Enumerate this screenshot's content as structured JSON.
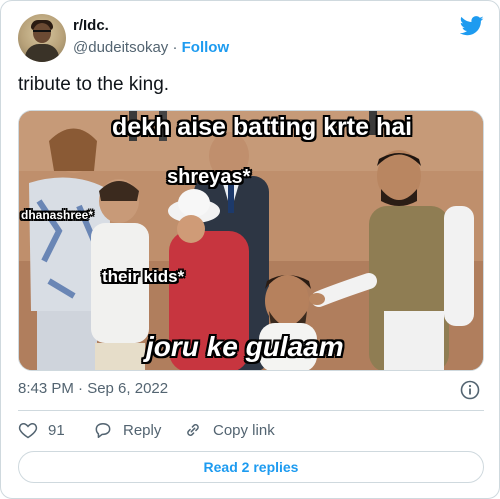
{
  "author": {
    "name": "r/Idc.",
    "handle": "@dudeitsokay",
    "separator": "·",
    "follow_label": "Follow",
    "avatar_icon": "profile-avatar"
  },
  "tweet": {
    "text": "tribute to the king.",
    "timestamp": "8:43 PM · Sep 6, 2022"
  },
  "meme": {
    "top_caption": "dekh aise batting krte hai",
    "label_shreyas": "shreyas*",
    "label_dhanashree": "dhanashree*",
    "label_kids": "their kids*",
    "bottom_caption": "joru ke gulaam"
  },
  "actions": {
    "like_count": "91",
    "reply_label": "Reply",
    "copy_label": "Copy link"
  },
  "footer": {
    "read_replies": "Read 2 replies"
  },
  "colors": {
    "accent": "#1d9bf0",
    "secondary_text": "#536471",
    "border": "#cfd9de"
  },
  "icons": [
    "twitter-bird-icon",
    "info-icon",
    "heart-icon",
    "reply-bubble-icon",
    "link-icon"
  ]
}
